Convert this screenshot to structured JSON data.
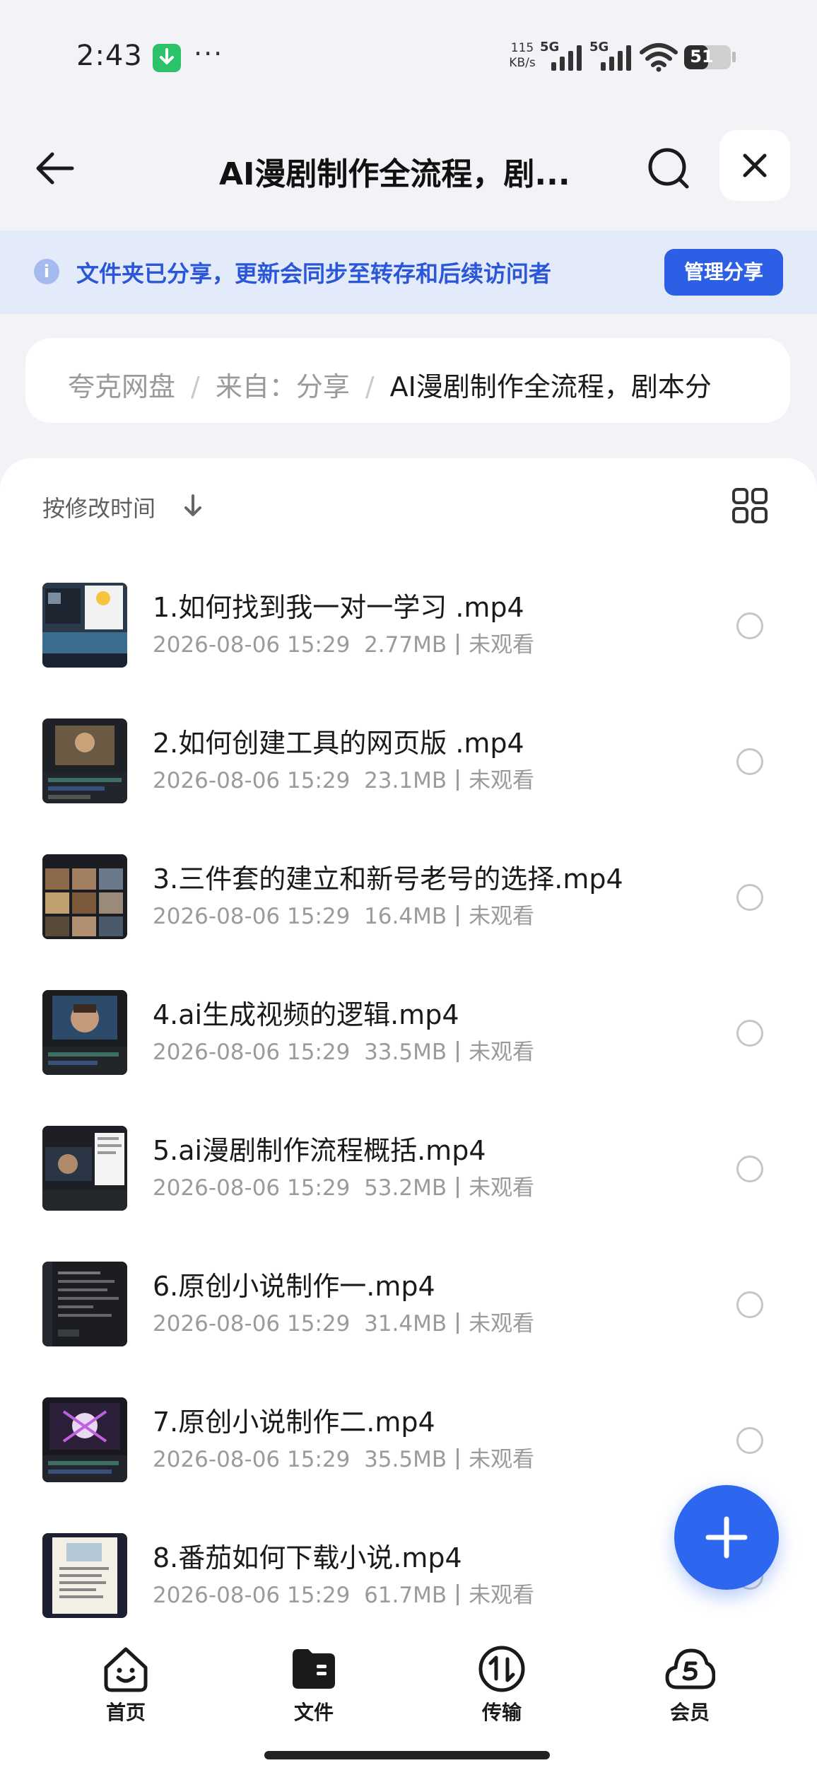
{
  "status_bar": {
    "time": "2:43",
    "more": "···",
    "speed_value": "115",
    "speed_unit": "KB/s",
    "network_1": "5G",
    "network_2": "5G",
    "battery": "51",
    "battery_level": 0.51
  },
  "header": {
    "title": "AI漫剧制作全流程，剧..."
  },
  "banner": {
    "text": "文件夹已分享，更新会同步至转存和后续访问者",
    "button": "管理分享"
  },
  "breadcrumb": {
    "items": [
      "夸克网盘",
      "来自：分享"
    ],
    "current": "AI漫剧制作全流程，剧本分"
  },
  "sort": {
    "label": "按修改时间"
  },
  "files": [
    {
      "name": "1.如何找到我一对一学习 .mp4",
      "date": "2026-08-06 15:29",
      "size": "2.77MB",
      "status": "未观看"
    },
    {
      "name": "2.如何创建工具的网页版 .mp4",
      "date": "2026-08-06 15:29",
      "size": "23.1MB",
      "status": "未观看"
    },
    {
      "name": "3.三件套的建立和新号老号的选择.mp4",
      "date": "2026-08-06 15:29",
      "size": "16.4MB",
      "status": "未观看"
    },
    {
      "name": "4.ai生成视频的逻辑.mp4",
      "date": "2026-08-06 15:29",
      "size": "33.5MB",
      "status": "未观看"
    },
    {
      "name": "5.ai漫剧制作流程概括.mp4",
      "date": "2026-08-06 15:29",
      "size": "53.2MB",
      "status": "未观看"
    },
    {
      "name": "6.原创小说制作一.mp4",
      "date": "2026-08-06 15:29",
      "size": "31.4MB",
      "status": "未观看"
    },
    {
      "name": "7.原创小说制作二.mp4",
      "date": "2026-08-06 15:29",
      "size": "35.5MB",
      "status": "未观看"
    },
    {
      "name": "8.番茄如何下载小说.mp4",
      "date": "2026-08-06 15:29",
      "size": "61.7MB",
      "status": "未观看"
    }
  ],
  "nav": {
    "home": "首页",
    "files": "文件",
    "transfer": "传输",
    "member": "会员"
  },
  "colors": {
    "accent": "#2c5fe6",
    "banner_bg": "#e3ebfb",
    "page_bg": "#f1f3f6"
  }
}
